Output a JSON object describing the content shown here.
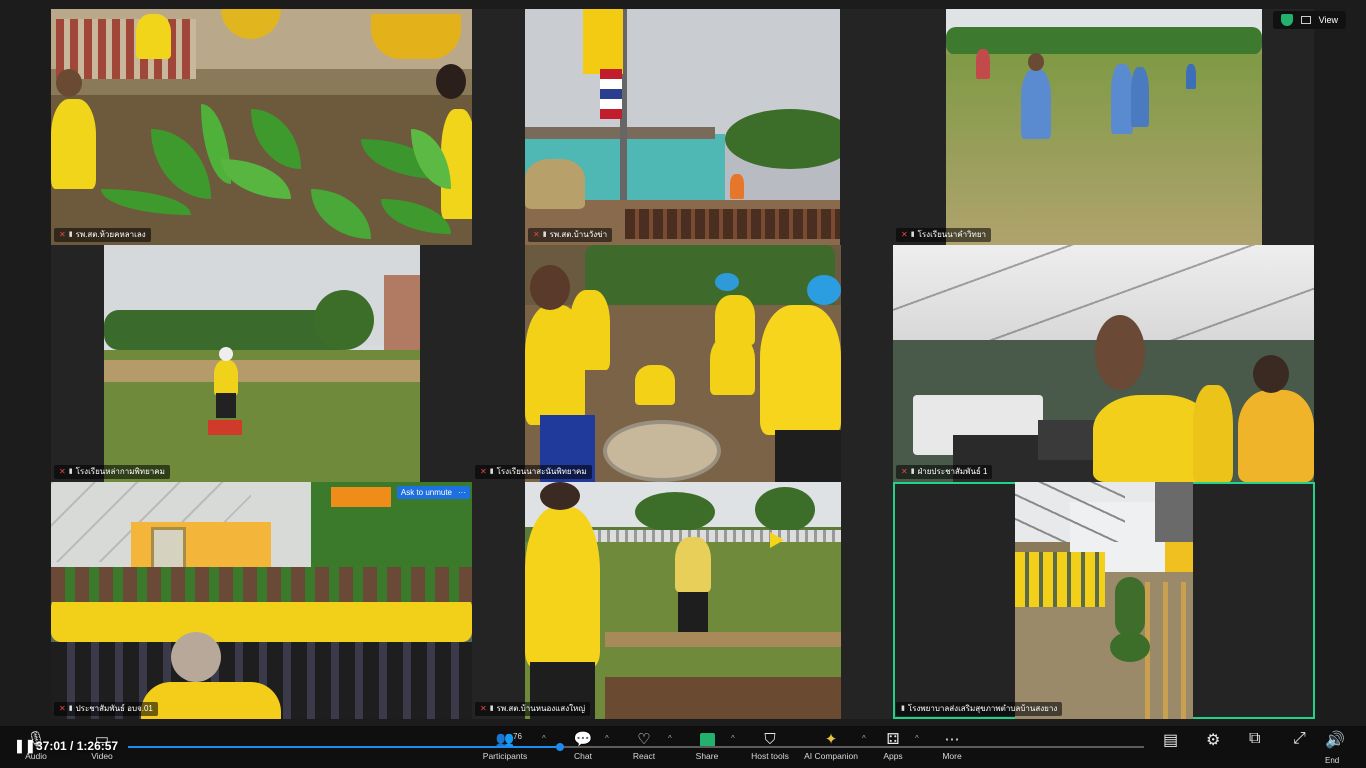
{
  "top_right": {
    "view_label": "View"
  },
  "tiles": [
    {
      "name": "รพ.สต.ห้วยคหลาเลง",
      "muted": true
    },
    {
      "name": "รพ.สต.บ้านวังข่า",
      "muted": true
    },
    {
      "name": "โรงเรียนนาคำวิทยา",
      "muted": true
    },
    {
      "name": "โรงเรียนหล่ากามพิทยาคม",
      "muted": true
    },
    {
      "name": "โรงเรียนนาสะนันพิทยาคม",
      "muted": true
    },
    {
      "name": "ฝ่ายประชาสัมพันธ์ 1",
      "muted": true
    },
    {
      "name": "ประชาสัมพันธ์ อบจ.01",
      "muted": true,
      "ask_to_unmute": "Ask to unmute",
      "more": "···"
    },
    {
      "name": "รพ.สต.บ้านหนองแสงใหญ่",
      "muted": true
    },
    {
      "name": "โรงพยาบาลส่งเสริมสุขภาพตำบลบ้านสงยาง",
      "muted": false,
      "active_speaker": true
    }
  ],
  "playback": {
    "current": "37:01",
    "duration": "1:26:57",
    "progress": 0.4256
  },
  "toolbar": {
    "audio": "Audio",
    "video": "Video",
    "participants": "Participants",
    "participants_count": "76",
    "chat": "Chat",
    "react": "React",
    "share": "Share",
    "host_tools": "Host tools",
    "ai_companion": "AI Companion",
    "apps": "Apps",
    "more": "More",
    "end": "End"
  }
}
